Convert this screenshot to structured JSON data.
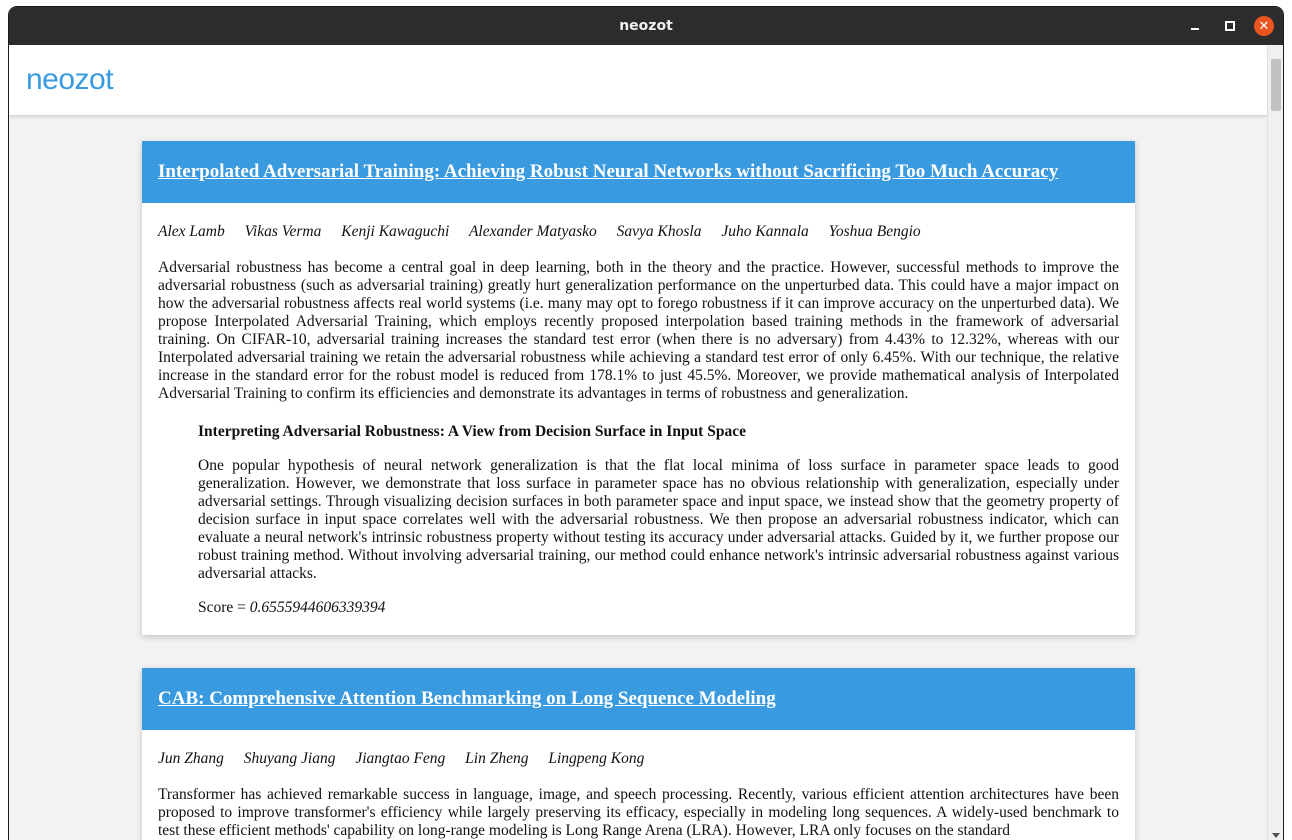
{
  "window": {
    "title": "neozot"
  },
  "app": {
    "logo": "neozot"
  },
  "papers": [
    {
      "title": "Interpolated Adversarial Training: Achieving Robust Neural Networks without Sacrificing Too Much Accuracy",
      "authors": [
        "Alex Lamb",
        "Vikas Verma",
        "Kenji Kawaguchi",
        "Alexander Matyasko",
        "Savya Khosla",
        "Juho Kannala",
        "Yoshua Bengio"
      ],
      "abstract": "Adversarial robustness has become a central goal in deep learning, both in the theory and the practice. However, successful methods to improve the adversarial robustness (such as adversarial training) greatly hurt generalization performance on the unperturbed data. This could have a major impact on how the adversarial robustness affects real world systems (i.e. many may opt to forego robustness if it can improve accuracy on the unperturbed data). We propose Interpolated Adversarial Training, which employs recently proposed interpolation based training methods in the framework of adversarial training. On CIFAR-10, adversarial training increases the standard test error (when there is no adversary) from 4.43% to 12.32%, whereas with our Interpolated adversarial training we retain the adversarial robustness while achieving a standard test error of only 6.45%. With our technique, the relative increase in the standard error for the robust model is reduced from 178.1% to just 45.5%. Moreover, we provide mathematical analysis of Interpolated Adversarial Training to confirm its efficiencies and demonstrate its advantages in terms of robustness and generalization.",
      "related": {
        "title": "Interpreting Adversarial Robustness: A View from Decision Surface in Input Space",
        "abstract": "One popular hypothesis of neural network generalization is that the flat local minima of loss surface in parameter space leads to good generalization. However, we demonstrate that loss surface in parameter space has no obvious relationship with generalization, especially under adversarial settings. Through visualizing decision surfaces in both parameter space and input space, we instead show that the geometry property of decision surface in input space correlates well with the adversarial robustness. We then propose an adversarial robustness indicator, which can evaluate a neural network's intrinsic robustness property without testing its accuracy under adversarial attacks. Guided by it, we further propose our robust training method. Without involving adversarial training, our method could enhance network's intrinsic adversarial robustness against various adversarial attacks.",
        "score_label": "Score = ",
        "score_value": "0.6555944606339394"
      }
    },
    {
      "title": "CAB: Comprehensive Attention Benchmarking on Long Sequence Modeling",
      "authors": [
        "Jun Zhang",
        "Shuyang Jiang",
        "Jiangtao Feng",
        "Lin Zheng",
        "Lingpeng Kong"
      ],
      "abstract": "Transformer has achieved remarkable success in language, image, and speech processing. Recently, various efficient attention architectures have been proposed to improve transformer's efficiency while largely preserving its efficacy, especially in modeling long sequences. A widely-used benchmark to test these efficient methods' capability on long-range modeling is Long Range Arena (LRA). However, LRA only focuses on the standard"
    }
  ],
  "colors": {
    "accent": "#3a9ae0",
    "titlebar": "#2c2c2c",
    "close_button": "#e95420",
    "background": "#f2f2f2"
  },
  "icons": {
    "minimize": "minimize-icon",
    "maximize": "maximize-icon",
    "close": "close-icon"
  }
}
